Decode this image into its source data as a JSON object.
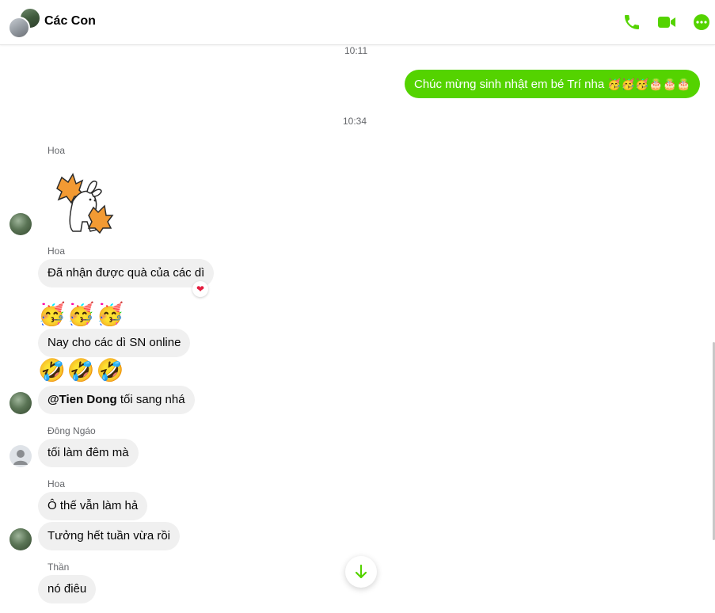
{
  "header": {
    "title": "Các Con",
    "accent": "#54d300"
  },
  "timestamps": [
    "10:11",
    "10:34"
  ],
  "messages": {
    "outgoing": {
      "text": "Chúc mừng sinh nhật em bé Trí nha",
      "emojis": "🥳🥳🥳🎂🎂🎂"
    },
    "hoa_1": {
      "sender": "Hoa",
      "sticker": "cheering-bunny-sticker"
    },
    "hoa_2": {
      "sender": "Hoa",
      "text": "Đã nhận được quà của các dì",
      "reaction": "❤"
    },
    "hoa_emojis_1": "🥳🥳🥳",
    "hoa_3": {
      "text": "Nay cho các dì SN online"
    },
    "hoa_emojis_2": "🤣🤣🤣",
    "hoa_4": {
      "mention": "@Tien Dong",
      "text": " tối sang nhá"
    },
    "dong_ngao": {
      "sender": "Đông Ngáo",
      "text": "tối làm đêm mà"
    },
    "hoa_5": {
      "sender": "Hoa",
      "text": "Ô thế vẫn làm hả"
    },
    "hoa_6": {
      "text": "Tưởng hết tuần vừa rồi"
    },
    "than": {
      "sender": "Thần",
      "text": "nó điêu"
    }
  }
}
